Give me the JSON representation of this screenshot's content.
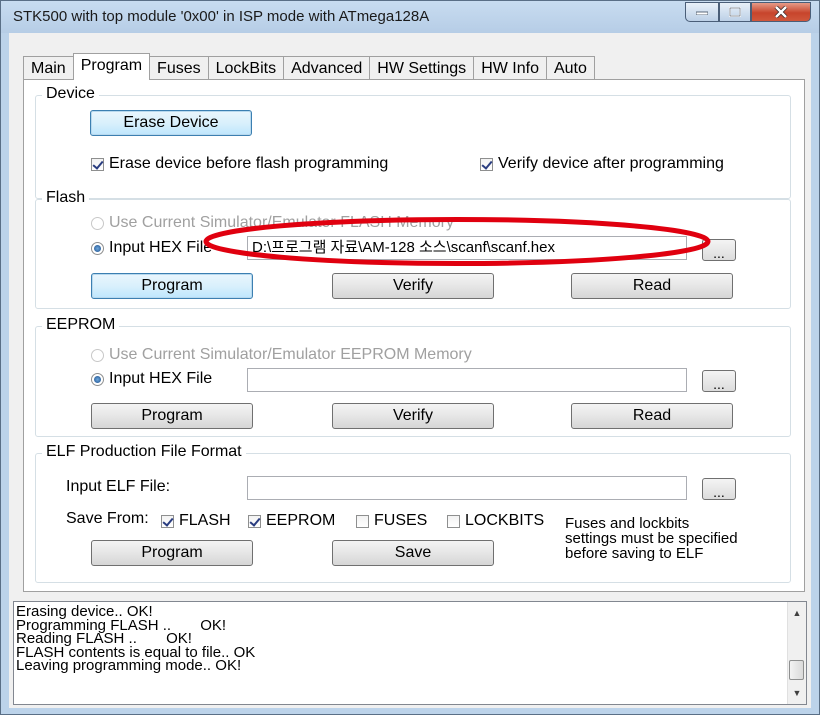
{
  "window": {
    "title": "STK500 with top module '0x00' in ISP mode with ATmega128A"
  },
  "tabs": [
    {
      "label": "Main"
    },
    {
      "label": "Program"
    },
    {
      "label": "Fuses"
    },
    {
      "label": "LockBits"
    },
    {
      "label": "Advanced"
    },
    {
      "label": "HW Settings"
    },
    {
      "label": "HW Info"
    },
    {
      "label": "Auto"
    }
  ],
  "device": {
    "legend": "Device",
    "erase_label": "Erase Device",
    "erase_before_flash_label": "Erase device before flash programming",
    "erase_before_flash_checked": true,
    "verify_after_label": "Verify device after programming",
    "verify_after_checked": true
  },
  "flash": {
    "legend": "Flash",
    "use_current_label": "Use Current Simulator/Emulator FLASH Memory",
    "input_hex_label": "Input HEX File",
    "hex_path": "D:\\프로그램 자료\\AM-128 소스\\scanf\\scanf.hex",
    "browse_label": "...",
    "program_label": "Program",
    "verify_label": "Verify",
    "read_label": "Read"
  },
  "eeprom": {
    "legend": "EEPROM",
    "use_current_label": "Use Current Simulator/Emulator EEPROM Memory",
    "input_hex_label": "Input HEX File",
    "hex_path": "",
    "browse_label": "...",
    "program_label": "Program",
    "verify_label": "Verify",
    "read_label": "Read"
  },
  "elf": {
    "legend": "ELF Production File Format",
    "input_label": "Input ELF File:",
    "path": "",
    "browse_label": "...",
    "save_from_label": "Save From:",
    "options": [
      {
        "label": "FLASH",
        "checked": true
      },
      {
        "label": "EEPROM",
        "checked": true
      },
      {
        "label": "FUSES",
        "checked": false
      },
      {
        "label": "LOCKBITS",
        "checked": false
      }
    ],
    "note_line1": "Fuses and lockbits",
    "note_line2": "settings must be specified",
    "note_line3": "before saving to ELF",
    "program_label": "Program",
    "save_label": "Save"
  },
  "log": {
    "lines": [
      "Erasing device.. OK!",
      "Programming FLASH ..       OK!",
      "Reading FLASH ..       OK!",
      "FLASH contents is equal to file.. OK",
      "Leaving programming mode.. OK!"
    ]
  },
  "colors": {
    "annotation": "#e0000f"
  }
}
